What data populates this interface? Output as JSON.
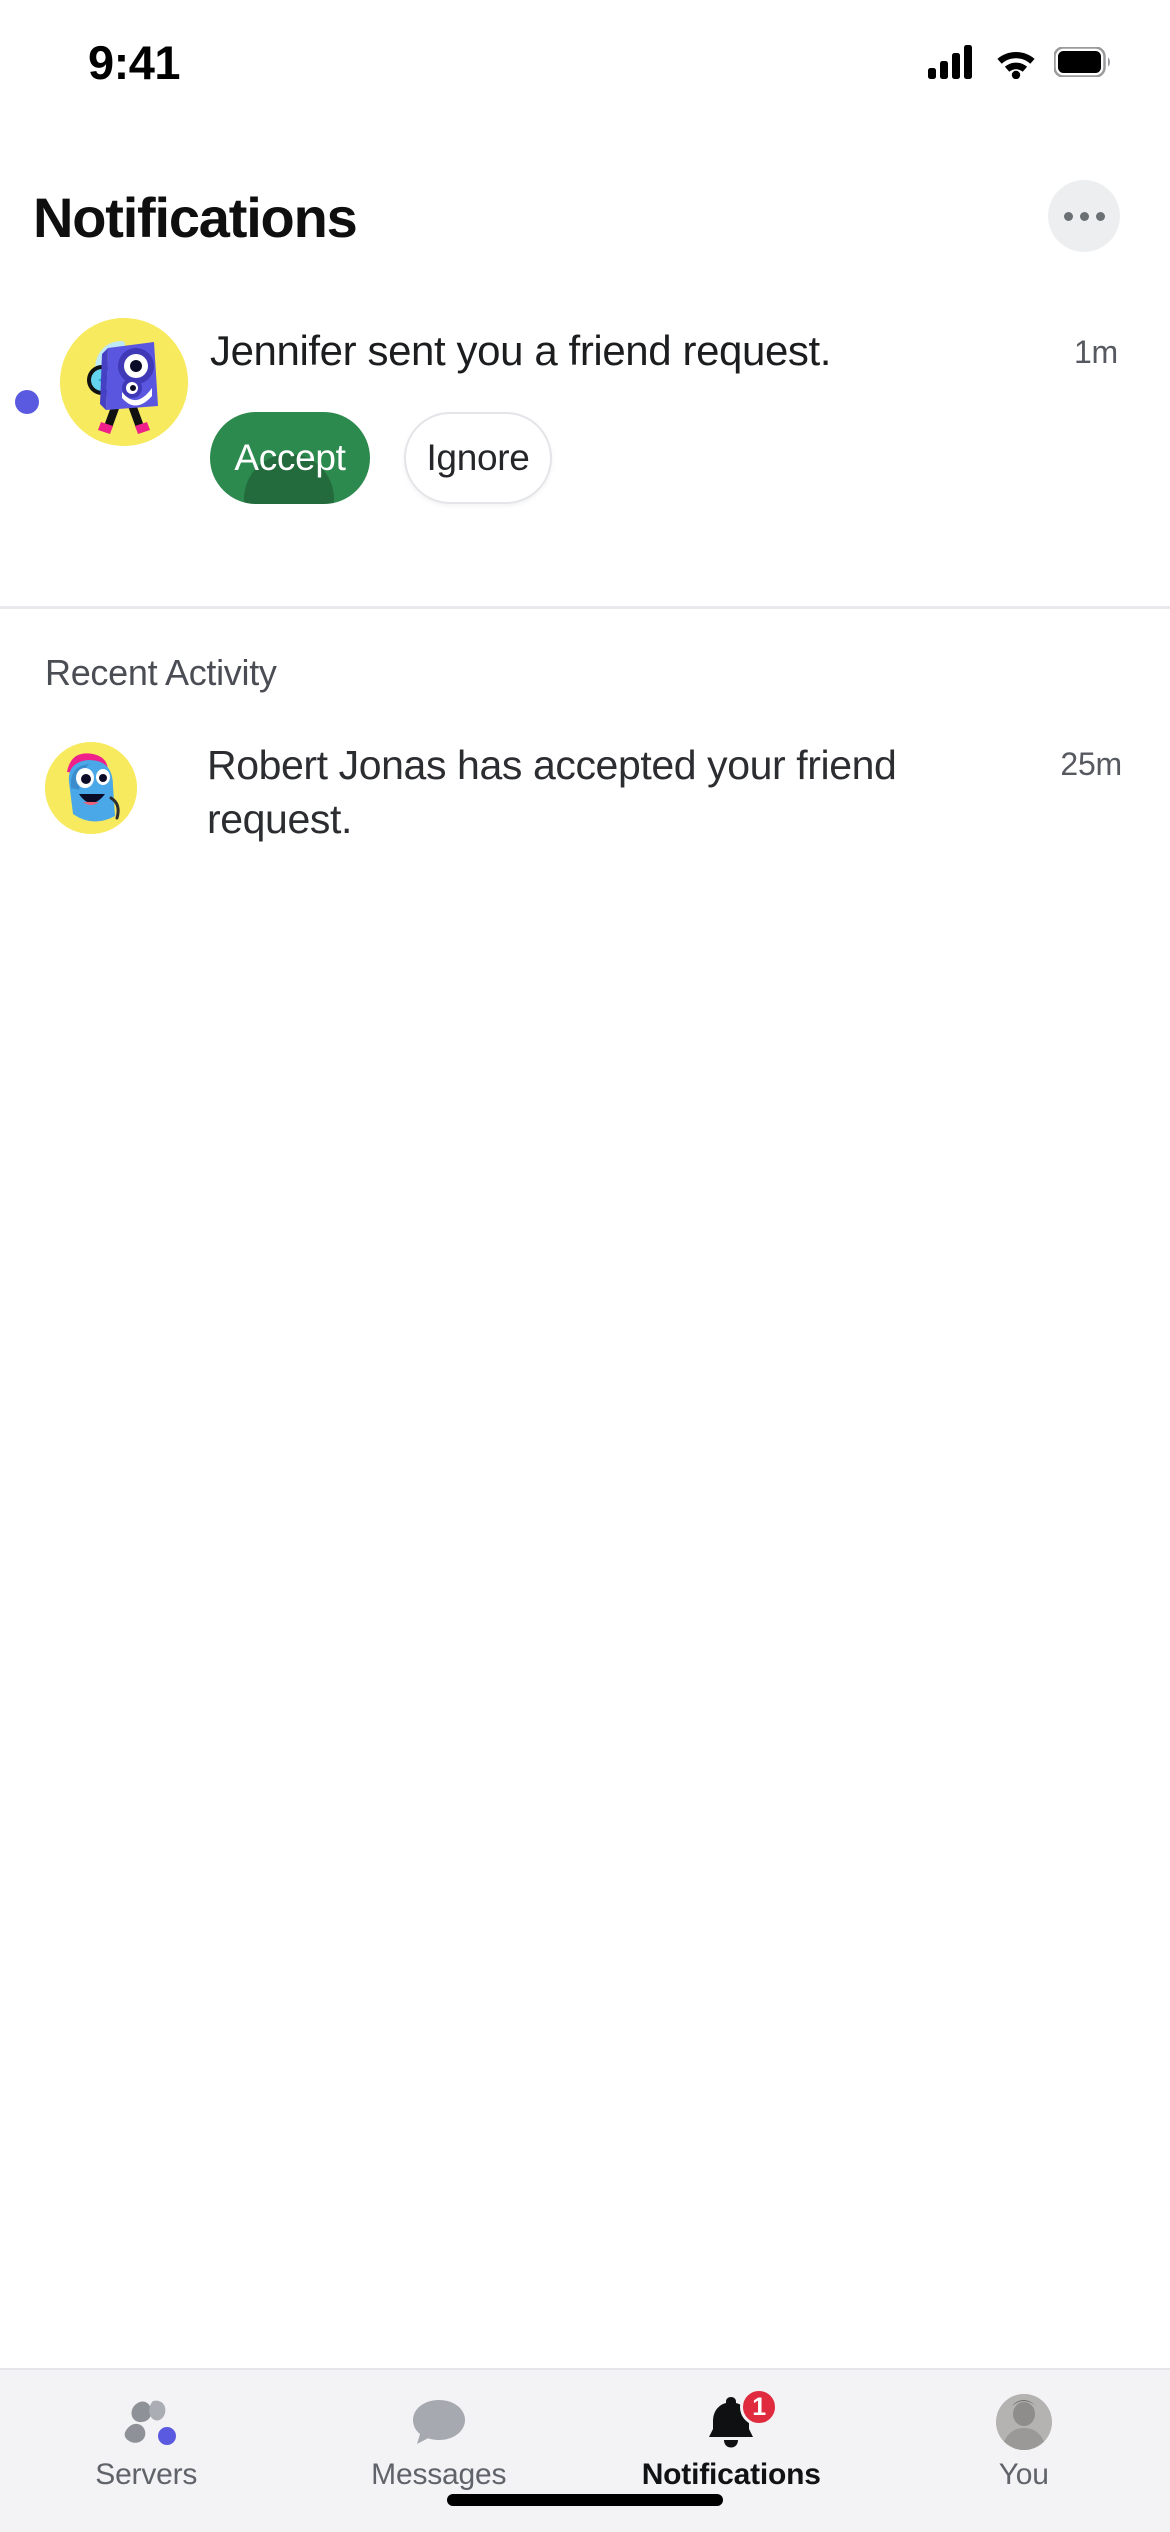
{
  "status_bar": {
    "time": "9:41",
    "cellular_icon": "cellular-signal-icon",
    "wifi_icon": "wifi-icon",
    "battery_icon": "battery-full-icon"
  },
  "header": {
    "title": "Notifications",
    "more_button_icon": "more-horizontal-icon"
  },
  "friend_request": {
    "unread": true,
    "avatar_icon": "avatar-jennifer-speaker-robot",
    "message": "Jennifer sent you a friend request.",
    "time": "1m",
    "accept_label": "Accept",
    "ignore_label": "Ignore",
    "accept_color": "#2d8a4e",
    "unread_dot_color": "#5a5ae0"
  },
  "recent_activity": {
    "title": "Recent Activity",
    "items": [
      {
        "avatar_icon": "avatar-robert-jonas-blue-character",
        "message": "Robert Jonas has accepted your friend request.",
        "time": "25m"
      }
    ]
  },
  "tab_bar": {
    "tabs": [
      {
        "label": "Servers",
        "icon": "servers-icon",
        "active": false,
        "badge_dot": true,
        "badge_count": ""
      },
      {
        "label": "Messages",
        "icon": "messages-icon",
        "active": false,
        "badge_dot": false,
        "badge_count": ""
      },
      {
        "label": "Notifications",
        "icon": "bell-icon",
        "active": true,
        "badge_dot": false,
        "badge_count": "1"
      },
      {
        "label": "You",
        "icon": "user-avatar-icon",
        "active": false,
        "badge_dot": false,
        "badge_count": ""
      }
    ],
    "badge_color": "#e02b3f",
    "dot_color": "#5a5ae0"
  }
}
